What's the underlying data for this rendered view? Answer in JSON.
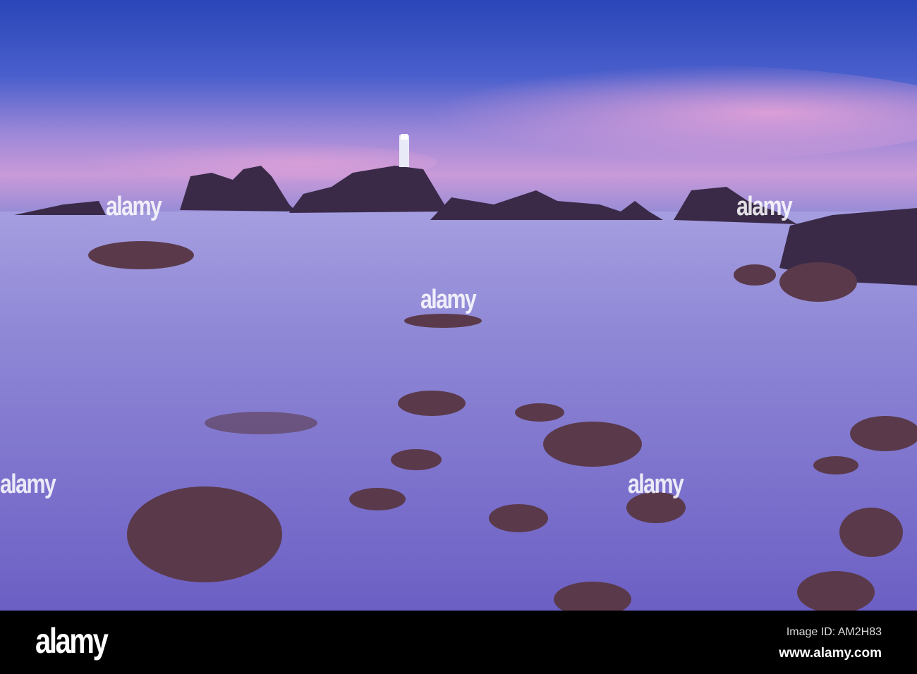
{
  "watermark": {
    "brand": "alamy"
  },
  "footer": {
    "logo": "alamy",
    "image_id": "Image ID: AM2H83",
    "url": "www.alamy.com"
  }
}
